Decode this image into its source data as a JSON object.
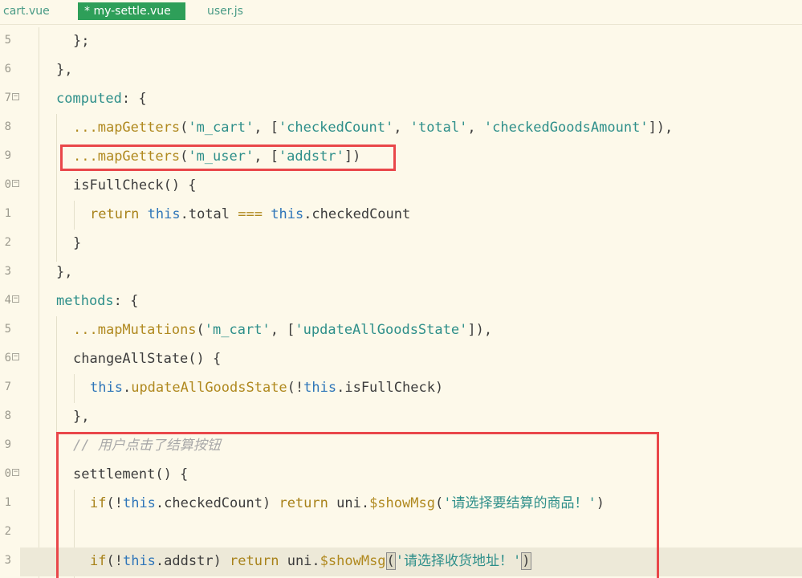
{
  "tabs": [
    {
      "label": "cart.vue",
      "active": false
    },
    {
      "label": "* my-settle.vue",
      "active": true
    },
    {
      "label": "user.js",
      "active": false
    }
  ],
  "lines": [
    {
      "num": "5",
      "fold": false,
      "indent": 1,
      "parts": [
        [
          "p",
          "};"
        ]
      ]
    },
    {
      "num": "6",
      "fold": false,
      "indent": 0,
      "parts": [
        [
          "p",
          "},"
        ]
      ]
    },
    {
      "num": "7",
      "fold": true,
      "indent": 0,
      "parts": [
        [
          "str",
          "computed"
        ],
        [
          "p",
          ": {"
        ]
      ]
    },
    {
      "num": "8",
      "fold": false,
      "indent": 1,
      "parts": [
        [
          "kw",
          "..."
        ],
        [
          "kw",
          "mapGetters"
        ],
        [
          "p",
          "("
        ],
        [
          "str",
          "'m_cart'"
        ],
        [
          "p",
          ", ["
        ],
        [
          "str",
          "'checkedCount'"
        ],
        [
          "p",
          ", "
        ],
        [
          "str",
          "'total'"
        ],
        [
          "p",
          ", "
        ],
        [
          "str",
          "'checkedGoodsAmount'"
        ],
        [
          "p",
          "]),"
        ]
      ]
    },
    {
      "num": "9",
      "fold": false,
      "indent": 1,
      "parts": [
        [
          "kw",
          "..."
        ],
        [
          "kw",
          "mapGetters"
        ],
        [
          "p",
          "("
        ],
        [
          "str",
          "'m_user'"
        ],
        [
          "p",
          ", ["
        ],
        [
          "str",
          "'addstr'"
        ],
        [
          "p",
          "])"
        ]
      ]
    },
    {
      "num": "0",
      "fold": true,
      "indent": 1,
      "parts": [
        [
          "p",
          "isFullCheck() {"
        ]
      ]
    },
    {
      "num": "1",
      "fold": false,
      "indent": 2,
      "parts": [
        [
          "ret",
          "return "
        ],
        [
          "this",
          "this"
        ],
        [
          "p",
          ".total "
        ],
        [
          "op",
          "==="
        ],
        [
          "p",
          " "
        ],
        [
          "this",
          "this"
        ],
        [
          "p",
          ".checkedCount"
        ]
      ]
    },
    {
      "num": "2",
      "fold": false,
      "indent": 1,
      "parts": [
        [
          "p",
          "}"
        ]
      ]
    },
    {
      "num": "3",
      "fold": false,
      "indent": 0,
      "parts": [
        [
          "p",
          "},"
        ]
      ]
    },
    {
      "num": "4",
      "fold": true,
      "indent": 0,
      "parts": [
        [
          "str",
          "methods"
        ],
        [
          "p",
          ": {"
        ]
      ]
    },
    {
      "num": "5",
      "fold": false,
      "indent": 1,
      "parts": [
        [
          "kw",
          "..."
        ],
        [
          "kw",
          "mapMutations"
        ],
        [
          "p",
          "("
        ],
        [
          "str",
          "'m_cart'"
        ],
        [
          "p",
          ", ["
        ],
        [
          "str",
          "'updateAllGoodsState'"
        ],
        [
          "p",
          "]),"
        ]
      ]
    },
    {
      "num": "6",
      "fold": true,
      "indent": 1,
      "parts": [
        [
          "p",
          "changeAllState() {"
        ]
      ]
    },
    {
      "num": "7",
      "fold": false,
      "indent": 2,
      "parts": [
        [
          "this",
          "this"
        ],
        [
          "p",
          "."
        ],
        [
          "kw",
          "updateAllGoodsState"
        ],
        [
          "p",
          "(!"
        ],
        [
          "this",
          "this"
        ],
        [
          "p",
          ".isFullCheck)"
        ]
      ]
    },
    {
      "num": "8",
      "fold": false,
      "indent": 1,
      "parts": [
        [
          "p",
          "},"
        ]
      ]
    },
    {
      "num": "9",
      "fold": false,
      "indent": 1,
      "parts": [
        [
          "cm",
          "// 用户点击了结算按钮"
        ]
      ]
    },
    {
      "num": "0",
      "fold": true,
      "indent": 1,
      "parts": [
        [
          "p",
          "settlement() {"
        ]
      ]
    },
    {
      "num": "1",
      "fold": false,
      "indent": 2,
      "parts": [
        [
          "ret",
          "if"
        ],
        [
          "p",
          "(!"
        ],
        [
          "this",
          "this"
        ],
        [
          "p",
          ".checkedCount) "
        ],
        [
          "ret",
          "return"
        ],
        [
          "p",
          " uni."
        ],
        [
          "kw",
          "$showMsg"
        ],
        [
          "p",
          "("
        ],
        [
          "str",
          "'请选择要结算的商品！'"
        ],
        [
          "p",
          ")"
        ]
      ]
    },
    {
      "num": "2",
      "fold": false,
      "indent": 2,
      "parts": []
    },
    {
      "num": "3",
      "fold": false,
      "indent": 2,
      "current": true,
      "parts": [
        [
          "ret",
          "if"
        ],
        [
          "p",
          "(!"
        ],
        [
          "this",
          "this"
        ],
        [
          "p",
          ".addstr) "
        ],
        [
          "ret",
          "return"
        ],
        [
          "p",
          " uni."
        ],
        [
          "kw",
          "$showMsg"
        ],
        [
          "paren",
          "("
        ],
        [
          "str",
          "'请选择收货地址！'"
        ],
        [
          "paren",
          ")"
        ]
      ]
    }
  ],
  "colors": {
    "background": "#fdf9ea",
    "active_tab": "#2e9f59",
    "highlight_box": "#e9474a",
    "string": "#2e8f8a",
    "keyword": "#b0891f",
    "this": "#2f76b9",
    "comment": "#a8a8a8"
  }
}
